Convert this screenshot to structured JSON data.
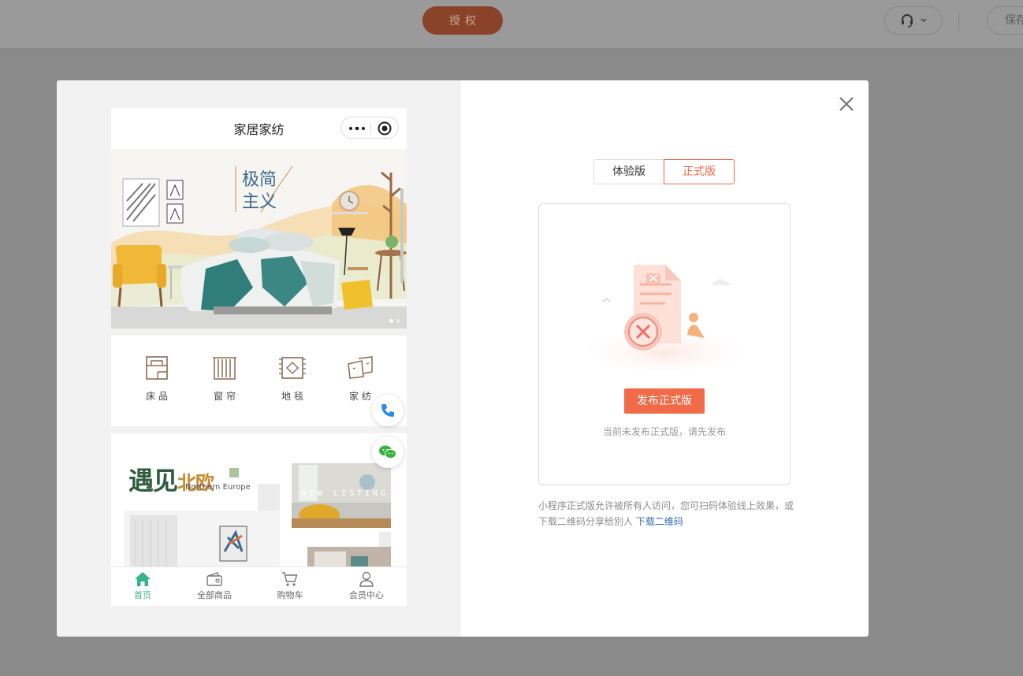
{
  "topbar": {
    "auth_label": "授权",
    "support_icon": "headset-icon",
    "save_label": "保存"
  },
  "modal": {
    "close_icon": "close-icon"
  },
  "phone": {
    "title": "家居家纺",
    "capsule": {
      "menu_icon": "more-dots-icon",
      "close_icon": "target-circle-icon"
    },
    "banner": {
      "slide_count": 2,
      "active_slide": 1
    },
    "categories": [
      {
        "label": "床品",
        "icon": "bed-icon"
      },
      {
        "label": "窗帘",
        "icon": "curtain-icon"
      },
      {
        "label": "地毯",
        "icon": "rug-icon"
      },
      {
        "label": "家纺",
        "icon": "pillow-icon"
      }
    ],
    "promo": {
      "title_part1": "遇见",
      "title_part2": "北欧",
      "subtitle": "Northern Europe",
      "badge": "NEW LISTING"
    },
    "float": {
      "phone_icon": "phone-icon",
      "wechat_icon": "wechat-icon"
    },
    "tabs": [
      {
        "label": "首页",
        "icon": "home-icon",
        "active": true
      },
      {
        "label": "全部商品",
        "icon": "wallet-icon",
        "active": false
      },
      {
        "label": "购物车",
        "icon": "cart-icon",
        "active": false
      },
      {
        "label": "会员中心",
        "icon": "user-icon",
        "active": false
      }
    ]
  },
  "release": {
    "tabs": {
      "trial": "体验版",
      "official": "正式版",
      "selected": "official"
    },
    "publish_label": "发布正式版",
    "empty_hint": "当前未发布正式版，请先发布",
    "description": "小程序正式版允许被所有人访问，您可扫码体验线上效果，或下载二维码分享给别人",
    "download_link": "下载二维码"
  },
  "colors": {
    "accent": "#f26a47",
    "tab_active": "#35b38c",
    "link": "#2f6db5"
  }
}
